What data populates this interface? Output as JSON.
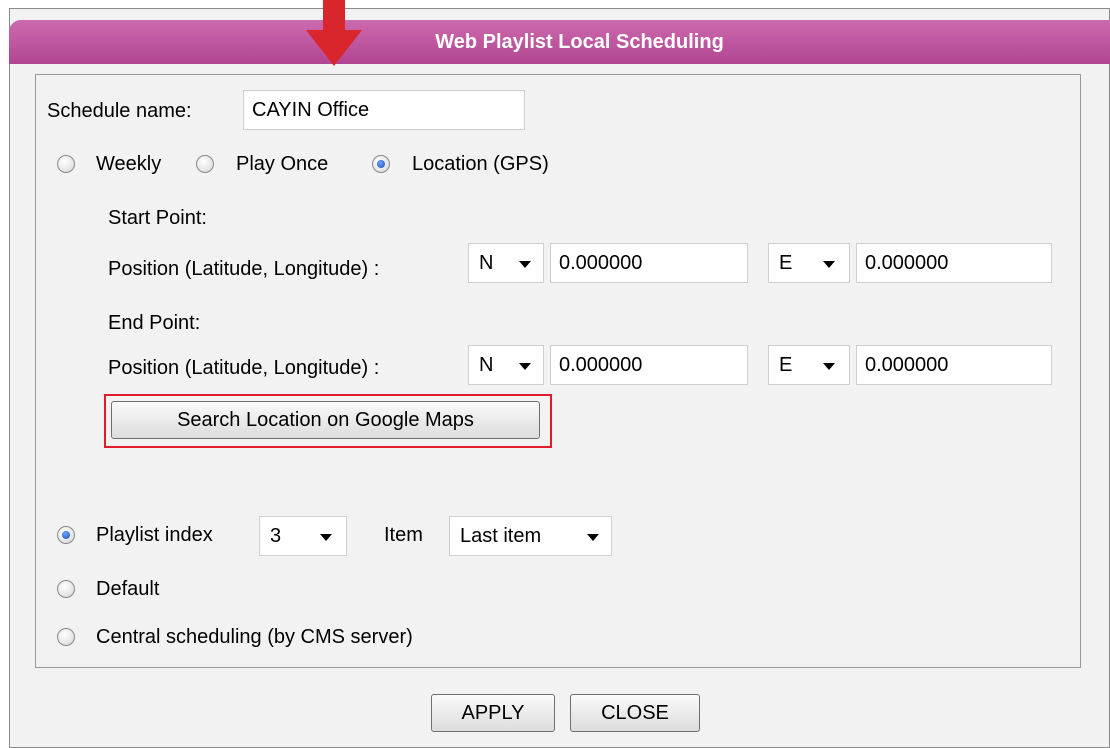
{
  "dialog": {
    "title": "Web Playlist Local Scheduling",
    "accent_color": "#b24592"
  },
  "schedule_name": {
    "label": "Schedule name:",
    "value": "CAYIN Office"
  },
  "schedule_type": {
    "options": [
      {
        "label": "Weekly",
        "checked": false
      },
      {
        "label": "Play Once",
        "checked": false
      },
      {
        "label": "Location (GPS)",
        "checked": true
      }
    ]
  },
  "start_point": {
    "heading": "Start Point:",
    "position_label": "Position (Latitude, Longitude) :",
    "lat_dir": "N",
    "lat_value": "0.000000",
    "lon_dir": "E",
    "lon_value": "0.000000"
  },
  "end_point": {
    "heading": "End Point:",
    "position_label": "Position (Latitude, Longitude) :",
    "lat_dir": "N",
    "lat_value": "0.000000",
    "lon_dir": "E",
    "lon_value": "0.000000"
  },
  "search_button": {
    "label": "Search Location on Google Maps",
    "highlight_color": "#e01b2b"
  },
  "playlist": {
    "radio_label": "Playlist index",
    "index_value": "3",
    "item_label": "Item",
    "item_value": "Last item",
    "checked": true
  },
  "default_option": {
    "label": "Default",
    "checked": false
  },
  "central_option": {
    "label": "Central scheduling (by CMS server)",
    "checked": false
  },
  "footer": {
    "apply_label": "APPLY",
    "close_label": "CLOSE"
  },
  "annotation": {
    "arrow_icon": "down-arrow-icon",
    "arrow_color": "#d9262c"
  }
}
